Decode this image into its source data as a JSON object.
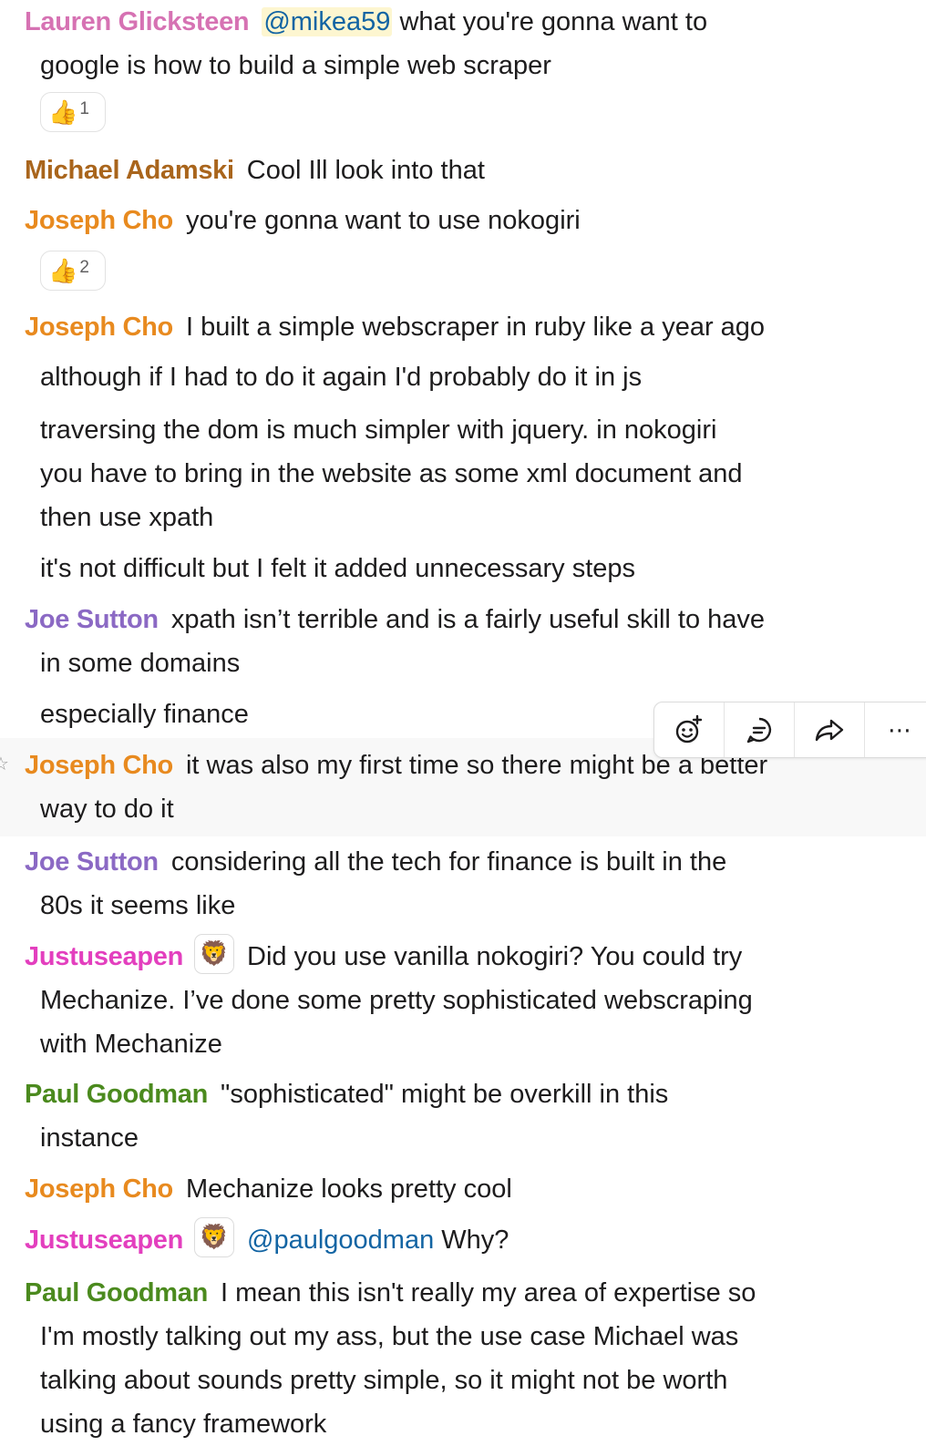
{
  "messages": [
    {
      "author": "Lauren Glicksteen",
      "color": "#d672b3",
      "mention": "@mikea59",
      "text_1": "what you're gonna want to",
      "text_2": "google is how to build a simple web scraper"
    },
    {
      "reaction": {
        "emoji": "👍",
        "count": "1"
      }
    },
    {
      "author": "Michael Adamski",
      "color": "#a9651c",
      "text": "Cool Ill look into that"
    },
    {
      "author": "Joseph Cho",
      "color": "#e88a1f",
      "text": "you're gonna want to use nokogiri"
    },
    {
      "reaction": {
        "emoji": "👍",
        "count": "2"
      }
    },
    {
      "author": "Joseph Cho",
      "color": "#e88a1f",
      "text": "I built a simple webscraper in ruby like a year ago"
    },
    {
      "text": "although if I had to do it again I'd probably do it in js"
    },
    {
      "lines": [
        "traversing the dom is much simpler with jquery. in nokogiri",
        "you have to bring in the website as some xml document and",
        "then use xpath"
      ]
    },
    {
      "text": "it's not difficult but I felt it added unnecessary steps"
    },
    {
      "author": "Joe Sutton",
      "color": "#8b69c4",
      "text_1": "xpath isn’t terrible and is a fairly useful skill to have",
      "text_2": "in some domains"
    },
    {
      "text": "especially finance"
    },
    {
      "author": "Joseph Cho",
      "color": "#e88a1f",
      "text_1": "it was also my first time so there might be a better",
      "text_2": "way to do it"
    },
    {
      "author": "Joe Sutton",
      "color": "#8b69c4",
      "text_1": "considering all the tech for finance is built in the",
      "text_2": "80s it seems like"
    },
    {
      "author": "Justuseapen",
      "color": "#e33fbe",
      "badge": "🦁",
      "text_1": "Did you use vanilla nokogiri? You could try",
      "text_2": "Mechanize. I’ve done some pretty sophisticated webscraping",
      "text_3": "with Mechanize"
    },
    {
      "author": "Paul Goodman",
      "color": "#4b8a1e",
      "text_1": "\"sophisticated\" might be overkill in this",
      "text_2": "instance"
    },
    {
      "author": "Joseph Cho",
      "color": "#e88a1f",
      "text": "Mechanize looks pretty cool"
    },
    {
      "author": "Justuseapen",
      "color": "#e33fbe",
      "badge": "🦁",
      "mention": "@paulgoodman",
      "text": "Why?"
    },
    {
      "author": "Paul Goodman",
      "color": "#4b8a1e",
      "text_1": "I mean this isn't really my area of expertise so",
      "text_2": "I'm mostly talking out my ass, but the use case Michael was",
      "text_3": "talking about sounds pretty simple, so it might not be worth",
      "text_4": "using a fancy framework"
    }
  ],
  "toolbar": {
    "icons": [
      "add-reaction-icon",
      "reply-in-thread-icon",
      "share-message-icon",
      "more-actions-icon"
    ],
    "more_label": "⋯"
  },
  "hover_star": "☆"
}
